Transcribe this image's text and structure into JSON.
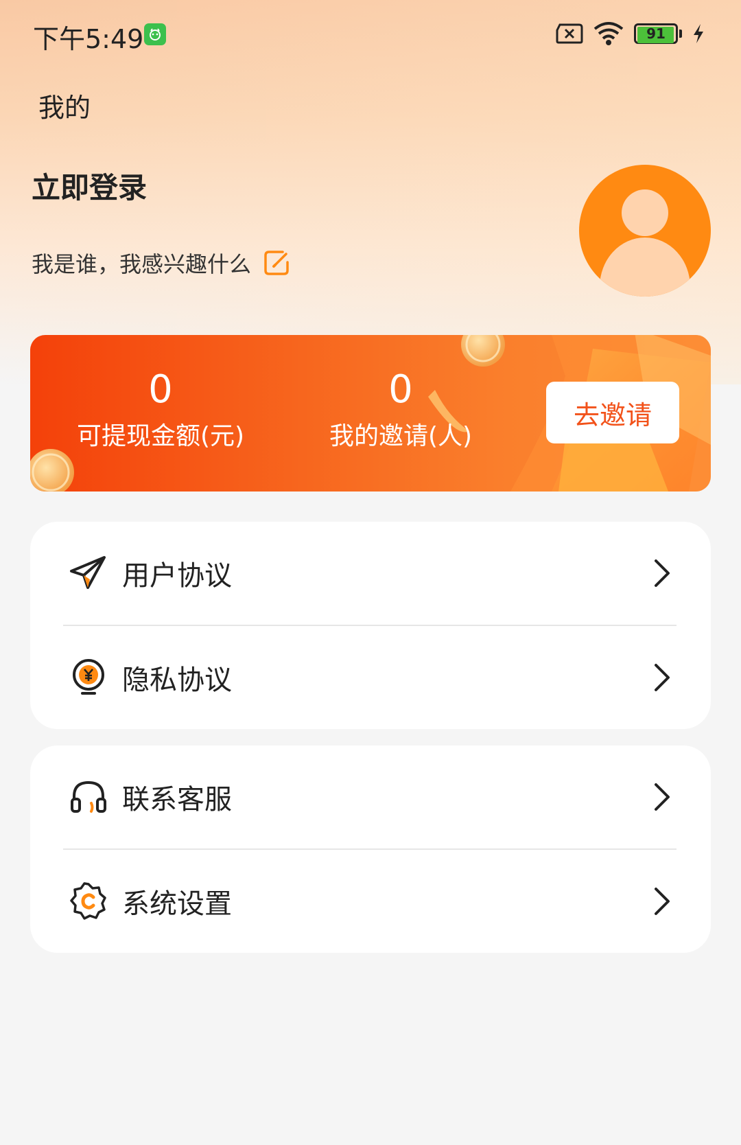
{
  "status_bar": {
    "time": "下午5:49",
    "battery_level": "91"
  },
  "page": {
    "title": "我的"
  },
  "profile": {
    "login_label": "立即登录",
    "bio_placeholder": "我是谁，我感兴趣什么"
  },
  "invite_banner": {
    "withdraw_amount": "0",
    "withdraw_label": "可提现金额(元)",
    "invite_count": "0",
    "invite_label": "我的邀请(人)",
    "invite_button": "去邀请"
  },
  "menu": {
    "group1": [
      {
        "label": "用户协议",
        "icon": "paper-plane-icon"
      },
      {
        "label": "隐私协议",
        "icon": "yuan-bulb-icon"
      }
    ],
    "group2": [
      {
        "label": "联系客服",
        "icon": "headset-icon"
      },
      {
        "label": "系统设置",
        "icon": "gear-icon"
      }
    ]
  },
  "colors": {
    "accent": "#ff8a12",
    "banner_start": "#f4410a",
    "banner_end": "#fb8a36",
    "invite_text": "#f2521a"
  }
}
